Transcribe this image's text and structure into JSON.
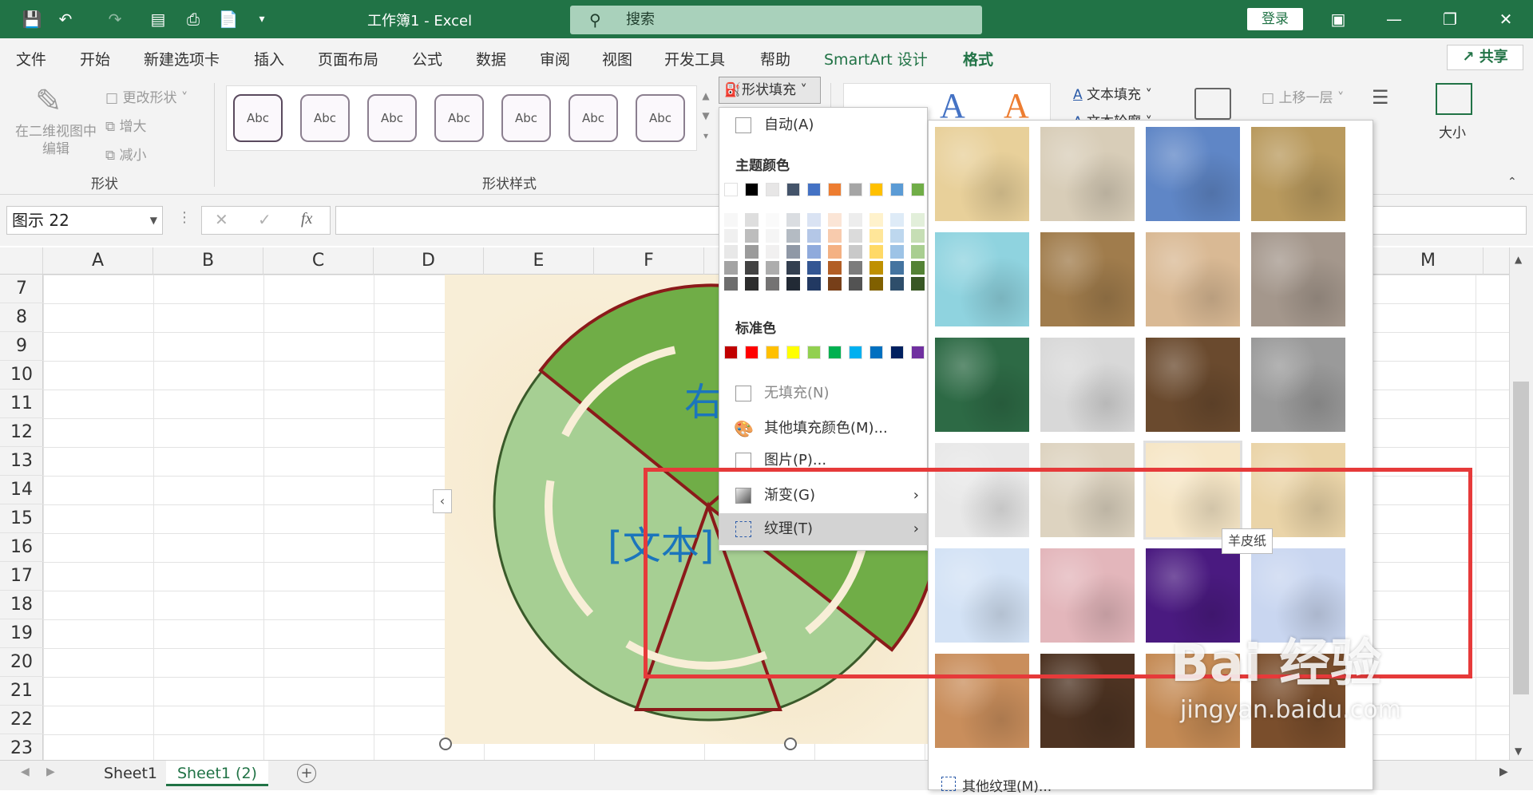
{
  "titlebar": {
    "doc_title": "工作簿1  -  Excel",
    "search_placeholder": "搜索",
    "login_label": "登录"
  },
  "tabs": [
    "文件",
    "开始",
    "新建选项卡",
    "插入",
    "页面布局",
    "公式",
    "数据",
    "审阅",
    "视图",
    "开发工具",
    "帮助",
    "SmartArt 设计",
    "格式"
  ],
  "share_label": "共享",
  "ribbon": {
    "edit_2d_label": "在二维视图中\n编辑",
    "change_shape_label": "更改形状",
    "enlarge_label": "增大",
    "shrink_label": "减小",
    "group_shapes_label": "形状",
    "style_sample_label": "Abc",
    "group_styles_label": "形状样式",
    "shape_fill_label": "形状填充",
    "text_fill_label": "文本填充",
    "text_outline_label": "文本轮廓",
    "bring_forward_label": "上移一层",
    "size_label": "大小"
  },
  "formula_bar": {
    "name_box_value": "图示 22",
    "fx_label": "fx"
  },
  "columns": [
    "A",
    "B",
    "C",
    "D",
    "E",
    "F",
    "M"
  ],
  "rows": [
    "7",
    "8",
    "9",
    "10",
    "11",
    "12",
    "13",
    "14",
    "15",
    "16",
    "17",
    "18",
    "19",
    "20",
    "21",
    "22",
    "23"
  ],
  "smartart": {
    "text_right": "右",
    "text_placeholder": "[文本]"
  },
  "fill_menu": {
    "auto": "自动(A)",
    "theme_colors_label": "主题颜色",
    "standard_colors_label": "标准色",
    "no_fill": "无填充(N)",
    "more_colors": "其他填充颜色(M)...",
    "picture": "图片(P)...",
    "gradient": "渐变(G)",
    "texture": "纹理(T)"
  },
  "theme_colors": [
    "#ffffff",
    "#000000",
    "#e7e6e6",
    "#44546a",
    "#4472c4",
    "#ed7d31",
    "#a5a5a5",
    "#ffc000",
    "#5b9bd5",
    "#70ad47"
  ],
  "standard_colors": [
    "#c00000",
    "#ff0000",
    "#ffc000",
    "#ffff00",
    "#92d050",
    "#00b050",
    "#00b0f0",
    "#0070c0",
    "#002060",
    "#7030a0"
  ],
  "texture_gallery": {
    "tooltip": "羊皮纸",
    "more_textures": "其他纹理(M)...",
    "textures": [
      {
        "name": "纸莎草纸",
        "color": "#e8d09a"
      },
      {
        "name": "画布",
        "color": "#d8cdb8"
      },
      {
        "name": "斜纹布",
        "color": "#5f86c6"
      },
      {
        "name": "编织物",
        "color": "#b99a5e"
      },
      {
        "name": "水滴",
        "color": "#8fd3df"
      },
      {
        "name": "纸袋",
        "color": "#a07c4c"
      },
      {
        "name": "鱼类化石",
        "color": "#d9b994"
      },
      {
        "name": "沙滩",
        "color": "#a4978c"
      },
      {
        "name": "绿色大理石",
        "color": "#2d6a45"
      },
      {
        "name": "白色大理石",
        "color": "#d8d8d8"
      },
      {
        "name": "褐色大理石",
        "color": "#6a4a2e"
      },
      {
        "name": "花岗岩",
        "color": "#9a9a9a"
      },
      {
        "name": "新闻纸",
        "color": "#e8e8e8"
      },
      {
        "name": "再生纸",
        "color": "#ddd3c0"
      },
      {
        "name": "羊皮纸",
        "color": "#f6e6c6"
      },
      {
        "name": "信纸",
        "color": "#ead4a8"
      },
      {
        "name": "蓝色面巾纸",
        "color": "#d3e2f5"
      },
      {
        "name": "粉色面巾纸",
        "color": "#e3b6bb"
      },
      {
        "name": "紫色网格",
        "color": "#4a1a80"
      },
      {
        "name": "花束",
        "color": "#c9d6f0"
      },
      {
        "name": "软木塞",
        "color": "#c98e5c"
      },
      {
        "name": "胡桃",
        "color": "#4d3322"
      },
      {
        "name": "橡木",
        "color": "#c48a54"
      },
      {
        "name": "中等木纹",
        "color": "#7a4e2c"
      }
    ]
  },
  "sheet_tabs": [
    "Sheet1",
    "Sheet1 (2)"
  ],
  "watermark": {
    "text": "Bai 经验",
    "sub": "jingyan.baidu.com"
  },
  "colors": {
    "excel_green": "#217346",
    "highlight_red": "#e63a3a",
    "smartart_green": "#70ad47"
  }
}
